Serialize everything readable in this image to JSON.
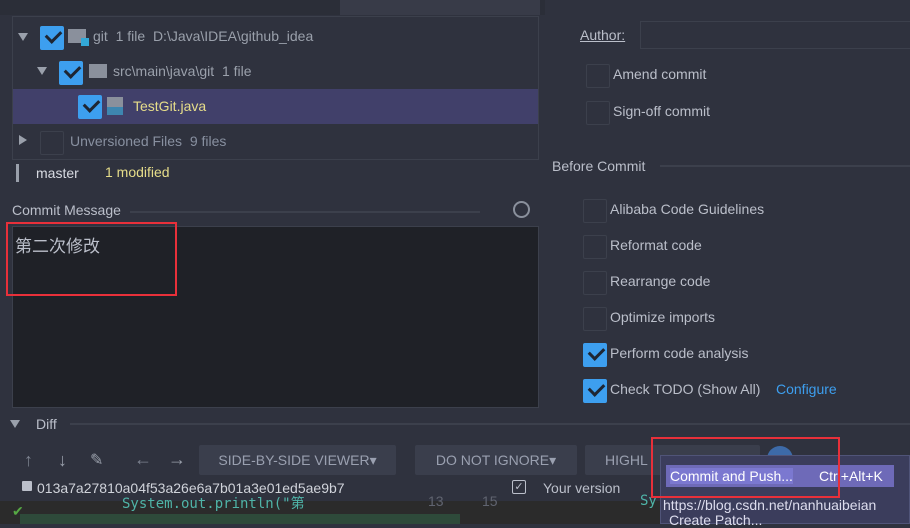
{
  "tree": {
    "root": {
      "name": "git",
      "count": "1 file",
      "path": "D:\\Java\\IDEA\\github_idea",
      "checked": true
    },
    "folder": {
      "name": "src\\main\\java\\git",
      "count": "1 file",
      "checked": true
    },
    "file": {
      "name": "TestGit.java",
      "checked": true
    },
    "unversioned": {
      "name": "Unversioned Files",
      "count": "9 files",
      "checked": false
    }
  },
  "status": {
    "branch": "master",
    "modified": "1 modified"
  },
  "commit_message": {
    "label": "Commit Message",
    "value": "第二次修改"
  },
  "right": {
    "author_label": "Author:",
    "author_value": "",
    "amend": "Amend commit",
    "signoff": "Sign-off commit",
    "before_commit": "Before Commit",
    "options": [
      {
        "label": "Alibaba Code Guidelines",
        "checked": false
      },
      {
        "label": "Reformat code",
        "checked": false
      },
      {
        "label": "Rearrange code",
        "checked": false
      },
      {
        "label": "Optimize imports",
        "checked": false
      },
      {
        "label": "Perform code analysis",
        "checked": true
      },
      {
        "label": "Check TODO (Show All)",
        "checked": true
      }
    ],
    "configure": "Configure"
  },
  "diff": {
    "label": "Diff",
    "viewer": "SIDE-BY-SIDE VIEWER",
    "ignore": "DO NOT IGNORE",
    "highlight": "HIGHL",
    "hash": "013a7a27810a04f53a26e6a7b01a3e01ed5ae9b7",
    "your_version": "Your version",
    "code_left": "System.out.println(\"第",
    "line_a": "13",
    "line_b": "15",
    "code_right": "Sy"
  },
  "popup": {
    "items": [
      {
        "label": "Commit and Push...",
        "shortcut": "Ctrl+Alt+K"
      },
      {
        "label": "Create Patch..."
      }
    ],
    "watermark": "https://blog.csdn.net/nanhuaibeian"
  },
  "colors": {
    "accent": "#3d9fef",
    "highlight": "#e8303a",
    "selection": "#41406a",
    "modified": "#e6dd8a"
  }
}
